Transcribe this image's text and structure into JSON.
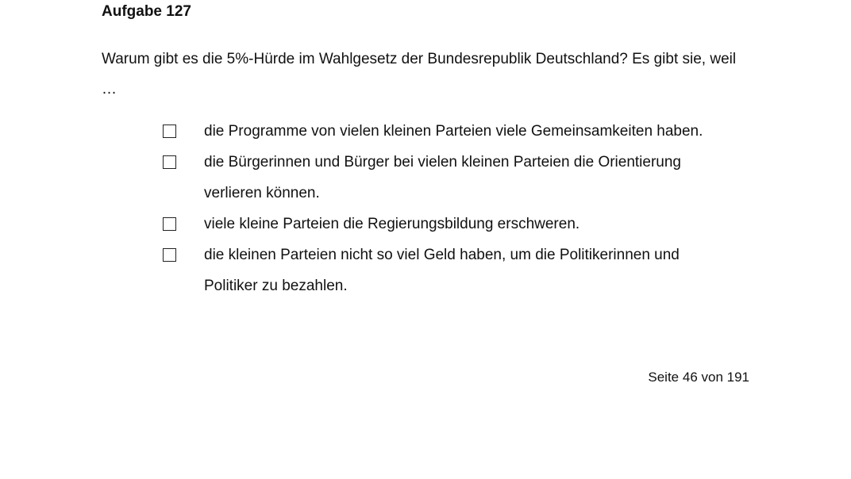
{
  "task": {
    "title": "Aufgabe 127",
    "question": "Warum gibt es die 5%-Hürde im Wahlgesetz der Bundesrepublik Deutschland? Es gibt sie, weil …"
  },
  "options": [
    {
      "text": "die Programme von vielen kleinen Parteien viele Gemeinsamkeiten haben."
    },
    {
      "text": "die Bürgerinnen und Bürger bei vielen kleinen Parteien die Orientierung verlieren können."
    },
    {
      "text": "viele kleine Parteien die Regierungsbildung erschweren."
    },
    {
      "text": "die kleinen Parteien nicht so viel Geld haben, um die Politikerinnen und Politiker zu bezahlen."
    }
  ],
  "footer": {
    "page_label": "Seite 46 von 191"
  }
}
